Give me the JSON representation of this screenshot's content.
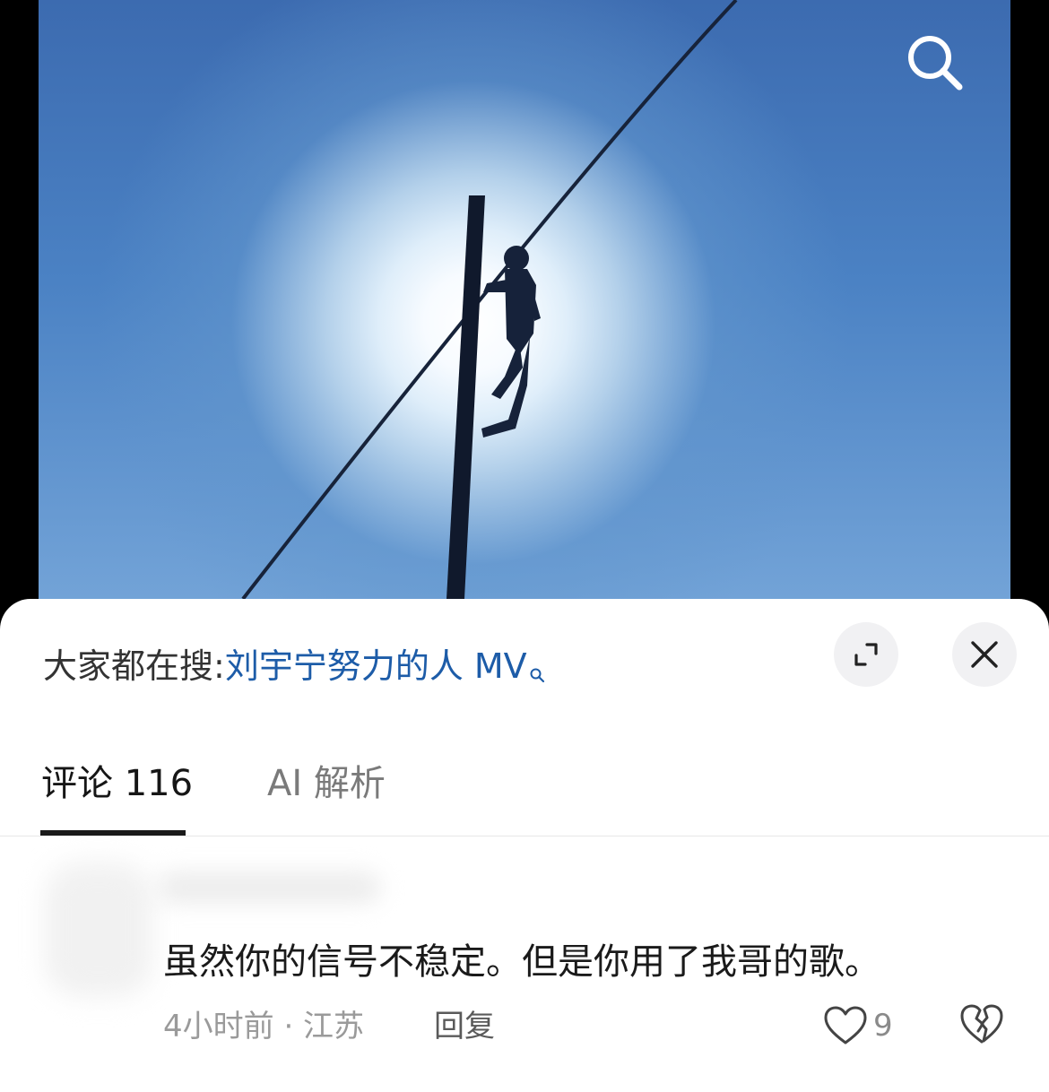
{
  "video": {
    "search_icon": "search-icon"
  },
  "search_bar": {
    "prefix": "大家都在搜:",
    "term": "刘宇宁努力的人 MV",
    "term_icon": "search-icon",
    "expand_icon": "expand-icon",
    "close_icon": "close-icon"
  },
  "tabs": [
    {
      "label": "评论 116",
      "active": true
    },
    {
      "label": "AI 解析",
      "active": false
    }
  ],
  "comment": {
    "text": "虽然你的信号不稳定。但是你用了我哥的歌。",
    "meta": "4小时前 · 江苏",
    "reply_label": "回复",
    "like_icon": "heart-icon",
    "like_count": "9",
    "dislike_icon": "broken-heart-icon"
  },
  "colors": {
    "link": "#1d5ca8",
    "active_tab": "#161616",
    "inactive_tab": "#7a7a7a"
  }
}
